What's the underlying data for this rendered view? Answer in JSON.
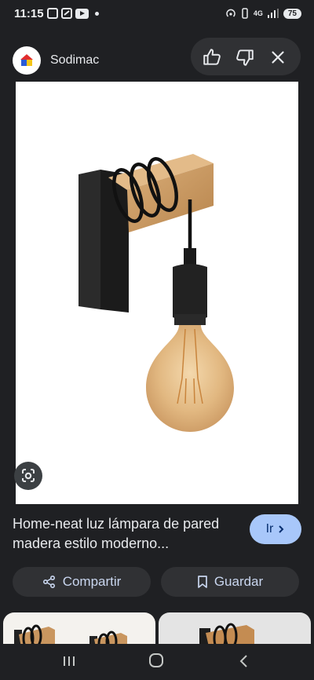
{
  "status_bar": {
    "time": "11:15",
    "network": "4G",
    "battery": "75"
  },
  "header": {
    "site_name": "Sodimac",
    "icons": [
      "sodimac-logo",
      "thumbs-up-icon",
      "thumbs-down-icon",
      "close-icon"
    ]
  },
  "result": {
    "title": "Home-neat luz lámpara de pared madera estilo moderno...",
    "visit_label": "Ir",
    "share_label": "Compartir",
    "save_label": "Guardar"
  },
  "colors": {
    "background": "#1f2023",
    "visit_button": "#a8c7fa",
    "pill": "#303134"
  },
  "nav": {
    "icons": [
      "recents-icon",
      "home-icon",
      "back-icon"
    ]
  }
}
